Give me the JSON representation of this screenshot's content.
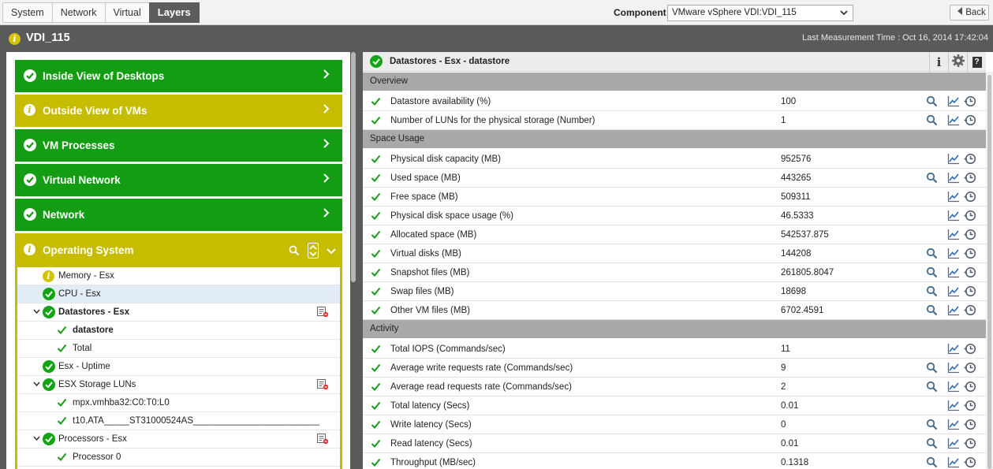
{
  "nav": {
    "tabs": [
      "System",
      "Network",
      "Virtual",
      "Layers"
    ],
    "active_tab": "Layers"
  },
  "component": {
    "label": "Component",
    "value": "VMware vSphere VDI:VDI_115"
  },
  "back_label": "Back",
  "title": "VDI_115",
  "measurement": "Last Measurement Time : Oct 16, 2014 17:42:04",
  "layers": [
    {
      "name": "Inside View of Desktops",
      "status": "ok"
    },
    {
      "name": "Outside View of VMs",
      "status": "warning"
    },
    {
      "name": "VM Processes",
      "status": "ok"
    },
    {
      "name": "Virtual Network",
      "status": "ok"
    },
    {
      "name": "Network",
      "status": "ok"
    }
  ],
  "os_layer": {
    "name": "Operating System",
    "tests": [
      {
        "label": "Memory - Esx",
        "status": "info",
        "level": 0
      },
      {
        "label": "CPU - Esx",
        "status": "ok",
        "level": 0,
        "selected": true
      },
      {
        "label": "Datastores - Esx",
        "status": "ok",
        "level": 0,
        "expanded": true,
        "bold": true
      },
      {
        "label": "datastore",
        "status": "check",
        "level": 1,
        "bold": true
      },
      {
        "label": "Total",
        "status": "check",
        "level": 1
      },
      {
        "label": "Esx - Uptime",
        "status": "ok",
        "level": 0
      },
      {
        "label": "ESX Storage LUNs",
        "status": "ok",
        "level": 0,
        "expanded": true
      },
      {
        "label": "mpx.vmhba32:C0:T0:L0",
        "status": "check",
        "level": 1
      },
      {
        "label": "t10.ATA_____ST31000524AS_________________________",
        "status": "check",
        "level": 1
      },
      {
        "label": "Processors - Esx",
        "status": "ok",
        "level": 0,
        "expanded": true
      },
      {
        "label": "Processor 0",
        "status": "check",
        "level": 1
      }
    ]
  },
  "details": {
    "title": "Datastores - Esx - datastore",
    "sections": [
      {
        "name": "Overview",
        "rows": [
          {
            "name": "Datastore availability (%)",
            "value": "100",
            "detail": true
          },
          {
            "name": "Number of LUNs for the physical storage (Number)",
            "value": "1",
            "detail": true
          }
        ]
      },
      {
        "name": "Space Usage",
        "rows": [
          {
            "name": "Physical disk capacity (MB)",
            "value": "952576",
            "detail": false
          },
          {
            "name": "Used space (MB)",
            "value": "443265",
            "detail": true
          },
          {
            "name": "Free space (MB)",
            "value": "509311",
            "detail": false
          },
          {
            "name": "Physical disk space usage (%)",
            "value": "46.5333",
            "detail": false
          },
          {
            "name": "Allocated space (MB)",
            "value": "542537.875",
            "detail": false
          },
          {
            "name": "Virtual disks (MB)",
            "value": "144208",
            "detail": true
          },
          {
            "name": "Snapshot files (MB)",
            "value": "261805.8047",
            "detail": true
          },
          {
            "name": "Swap files (MB)",
            "value": "18698",
            "detail": true
          },
          {
            "name": "Other VM files (MB)",
            "value": "6702.4591",
            "detail": true
          }
        ]
      },
      {
        "name": "Activity",
        "rows": [
          {
            "name": "Total IOPS (Commands/sec)",
            "value": "11",
            "detail": false
          },
          {
            "name": "Average write requests rate (Commands/sec)",
            "value": "9",
            "detail": true
          },
          {
            "name": "Average read requests rate (Commands/sec)",
            "value": "2",
            "detail": true
          },
          {
            "name": "Total latency (Secs)",
            "value": "0.01",
            "detail": false
          },
          {
            "name": "Write latency (Secs)",
            "value": "0",
            "detail": true
          },
          {
            "name": "Read latency (Secs)",
            "value": "0.01",
            "detail": true
          },
          {
            "name": "Throughput (MB/sec)",
            "value": "0.1318",
            "detail": true
          }
        ]
      }
    ]
  },
  "colors": {
    "ok_green": "#139d13",
    "warn_yellow": "#c7bd00",
    "check_green": "#1a9c1a"
  },
  "icons": [
    "check-circle-icon",
    "info-icon",
    "chevron-right-icon",
    "search-icon",
    "graph-icon",
    "history-icon",
    "gear-icon",
    "help-icon",
    "details-icon"
  ]
}
